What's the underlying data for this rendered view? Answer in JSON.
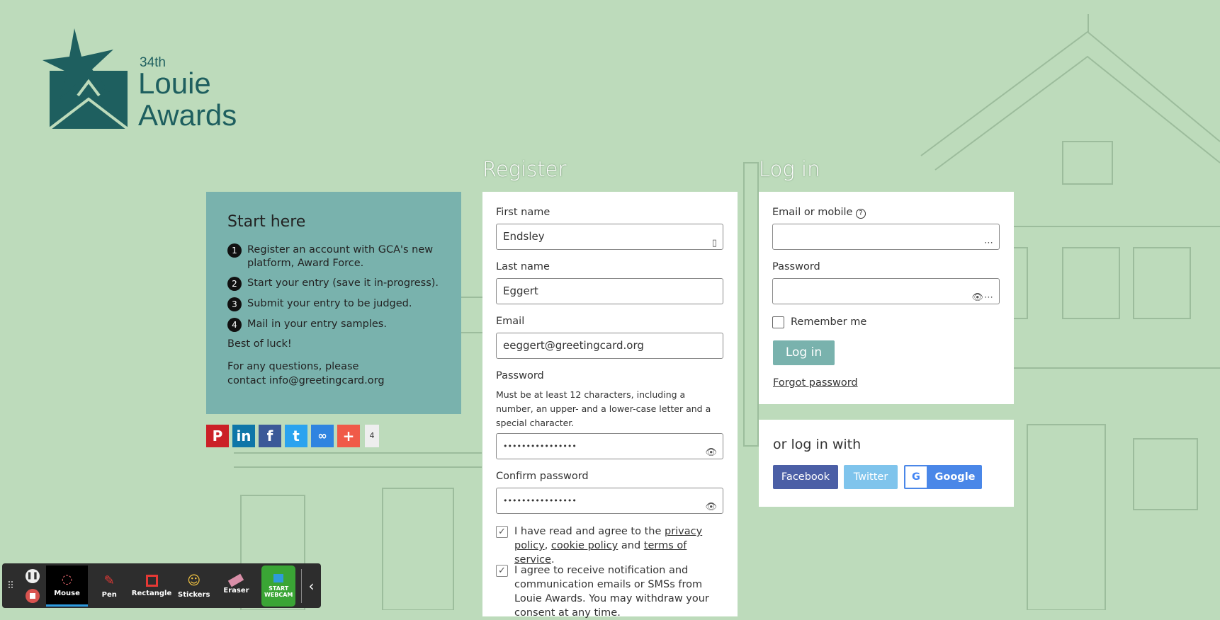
{
  "logo": {
    "edition": "34th",
    "line1": "Louie",
    "line2": "Awards"
  },
  "start": {
    "title": "Start here",
    "steps": [
      "Register an account with GCA's new platform, Award Force.",
      "Start your entry (save it in-progress).",
      "Submit your entry to be judged.",
      "Mail in your entry samples."
    ],
    "luck": "Best of luck!",
    "contact": "For any questions, please contact info@greetingcard.org"
  },
  "share": {
    "count": "4"
  },
  "register": {
    "title": "Register",
    "first_name_label": "First name",
    "first_name": "Endsley",
    "last_name_label": "Last name",
    "last_name": "Eggert",
    "email_label": "Email",
    "email": "eeggert@greetingcard.org",
    "password_label": "Password",
    "password_help": "Must be at least 12 characters, including a number, an upper- and a lower-case letter and a special character.",
    "password": "••••••••••••••••",
    "confirm_label": "Confirm password",
    "confirm": "••••••••••••••••",
    "agree1_a": "I have read and agree to the ",
    "privacy": "privacy policy",
    "comma": ",",
    "cookie": "cookie policy",
    "and": " and ",
    "terms": "terms of service",
    "period": ".",
    "agree2": "I agree to receive notification and communication emails or SMSs from Louie Awards. You may withdraw your consent at any time."
  },
  "login": {
    "title": "Log in",
    "email_label": "Email or mobile",
    "password_label": "Password",
    "remember": "Remember me",
    "login_button": "Log in",
    "forgot": "Forgot password",
    "or_with": "or log in with",
    "facebook": "Facebook",
    "twitter": "Twitter",
    "google": "Google"
  },
  "toolbar": {
    "mouse": "Mouse",
    "pen": "Pen",
    "rectangle": "Rectangle",
    "stickers": "Stickers",
    "eraser": "Eraser",
    "webcam": "START WEBCAM"
  }
}
